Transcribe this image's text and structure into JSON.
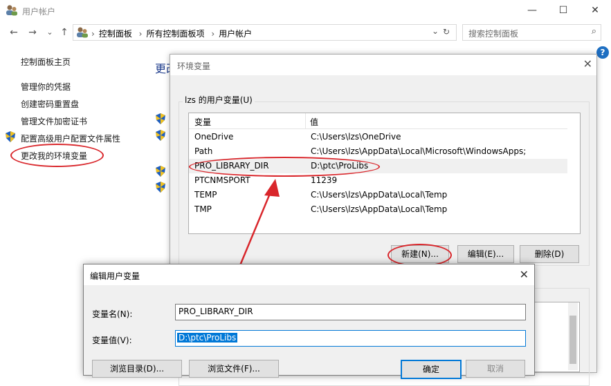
{
  "window": {
    "title": "用户帐户",
    "min": "—",
    "max": "☐",
    "close": "✕"
  },
  "nav": {
    "back": "←",
    "forward": "→",
    "history": "⌄",
    "up": "↑",
    "breadcrumbs": [
      "控制面板",
      "所有控制面板项",
      "用户帐户"
    ],
    "separator": "›",
    "dropdown": "⌄",
    "refresh": "↻",
    "search_placeholder": "搜索控制面板",
    "help": "?"
  },
  "left_nav": {
    "home": "控制面板主页",
    "items": [
      "管理你的凭据",
      "创建密码重置盘",
      "管理文件加密证书",
      "配置高级用户配置文件属性",
      "更改我的环境变量"
    ]
  },
  "main": {
    "heading_partial": "更改"
  },
  "env_dialog": {
    "title": "环境变量",
    "close": "✕",
    "user_group_label": "lzs 的用户变量(U)",
    "columns": [
      "变量",
      "值"
    ],
    "rows": [
      {
        "name": "OneDrive",
        "value": "C:\\Users\\lzs\\OneDrive"
      },
      {
        "name": "Path",
        "value": "C:\\Users\\lzs\\AppData\\Local\\Microsoft\\WindowsApps;"
      },
      {
        "name": "PRO_LIBRARY_DIR",
        "value": "D:\\ptc\\ProLibs"
      },
      {
        "name": "PTCNMSPORT",
        "value": "11239"
      },
      {
        "name": "TEMP",
        "value": "C:\\Users\\lzs\\AppData\\Local\\Temp"
      },
      {
        "name": "TMP",
        "value": "C:\\Users\\lzs\\AppData\\Local\\Temp"
      }
    ],
    "buttons": {
      "new": "新建(N)...",
      "edit": "编辑(E)...",
      "delete": "删除(D)"
    }
  },
  "edit_dialog": {
    "title": "编辑用户变量",
    "close": "✕",
    "name_label": "变量名(N):",
    "name_value": "PRO_LIBRARY_DIR",
    "value_label": "变量值(V):",
    "value_value": "D:\\ptc\\ProLibs",
    "buttons": {
      "browse_dir": "浏览目录(D)...",
      "browse_file": "浏览文件(F)...",
      "ok": "确定",
      "cancel": "取消"
    }
  },
  "colors": {
    "annotation": "#d9262b",
    "selection": "#0078d7",
    "accent": "#1e6fc2"
  }
}
